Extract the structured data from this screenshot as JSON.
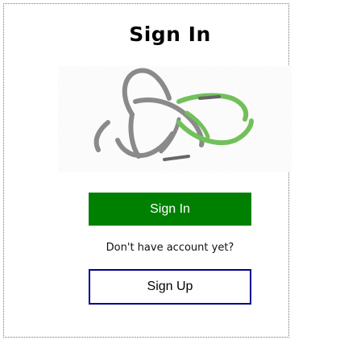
{
  "page": {
    "title": "Sign In"
  },
  "logo": {
    "icon": "intertwined-rings-logo",
    "colors": {
      "gray": "#8a8a8a",
      "green": "#72c05a"
    }
  },
  "signin": {
    "label": "Sign In",
    "color": "#008000"
  },
  "signup": {
    "prompt": "Don't have account yet?",
    "label": "Sign Up",
    "border_color": "#00008b"
  }
}
